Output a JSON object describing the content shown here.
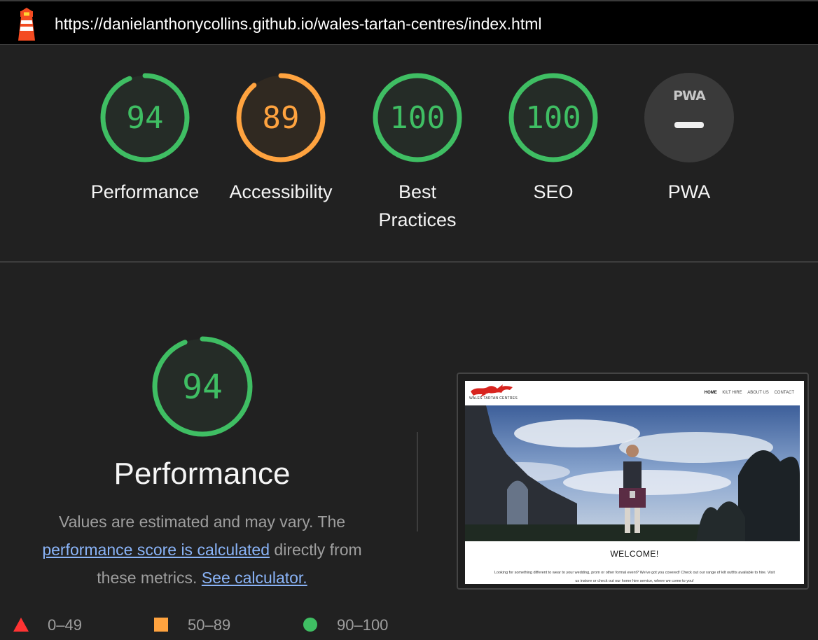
{
  "url": "https://danielanthonycollins.github.io/wales-tartan-centres/index.html",
  "colors": {
    "pass": "#3fbe63",
    "average": "#ffa33f",
    "fail": "#ff3333",
    "background": "#212121"
  },
  "categories": [
    {
      "name": "performance",
      "label": "Performance",
      "score": "94",
      "value": 94,
      "status": "pass"
    },
    {
      "name": "accessibility",
      "label": "Accessibility",
      "score": "89",
      "value": 89,
      "status": "average"
    },
    {
      "name": "best-practices",
      "label": "Best Practices",
      "score": "100",
      "value": 100,
      "status": "pass"
    },
    {
      "name": "seo",
      "label": "SEO",
      "score": "100",
      "value": 100,
      "status": "pass"
    },
    {
      "name": "pwa",
      "label": "PWA",
      "badge_text": "PWA",
      "status": "na"
    }
  ],
  "performance": {
    "score": "94",
    "value": 94,
    "title": "Performance",
    "desc_before": "Values are estimated and may vary. The ",
    "desc_link": "performance score is calculated",
    "desc_middle": " directly from these metrics. ",
    "desc_link2": "See calculator."
  },
  "screenshot": {
    "site_name": "WALES TARTAN CENTRES",
    "nav": [
      "HOME",
      "KILT HIRE",
      "ABOUT US",
      "CONTACT"
    ],
    "heading": "WELCOME!",
    "body": "Looking for something different to wear to your wedding, prom or other formal event? We've got you covered! Check out our range of kilt outfits available to hire. Visit us instore or check out our home hire service, where we come to you!"
  },
  "legend": [
    {
      "range": "0–49",
      "shape": "triangle"
    },
    {
      "range": "50–89",
      "shape": "square"
    },
    {
      "range": "90–100",
      "shape": "circle"
    }
  ]
}
